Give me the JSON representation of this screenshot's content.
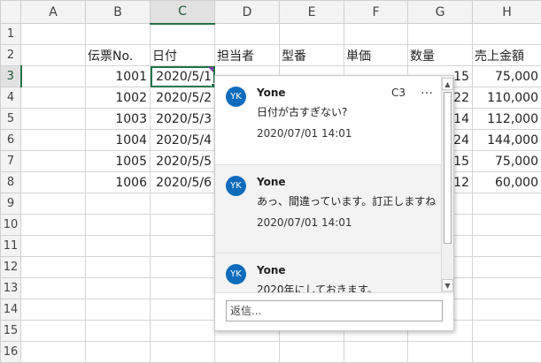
{
  "columns": [
    "A",
    "B",
    "C",
    "D",
    "E",
    "F",
    "G",
    "H"
  ],
  "rows": [
    "1",
    "2",
    "3",
    "4",
    "5",
    "6",
    "7",
    "8",
    "9",
    "10",
    "11",
    "12",
    "13",
    "14",
    "15",
    "16"
  ],
  "headers": {
    "slip_no": "伝票No.",
    "date": "日付",
    "person": "担当者",
    "model": "型番",
    "unit_price": "単価",
    "quantity": "数量",
    "sales_amount": "売上金額"
  },
  "records": [
    {
      "slip": "1001",
      "date": "2020/5/1",
      "qty_tail": "15",
      "amount": "75,000"
    },
    {
      "slip": "1002",
      "date": "2020/5/2",
      "qty_tail": "22",
      "amount": "110,000"
    },
    {
      "slip": "1003",
      "date": "2020/5/3",
      "qty_tail": "14",
      "amount": "112,000"
    },
    {
      "slip": "1004",
      "date": "2020/5/4",
      "qty_tail": "24",
      "amount": "144,000"
    },
    {
      "slip": "1005",
      "date": "2020/5/5",
      "qty_tail": "15",
      "amount": "75,000"
    },
    {
      "slip": "1006",
      "date": "2020/5/6",
      "qty_tail": "12",
      "amount": "60,000"
    }
  ],
  "comment": {
    "cell_ref": "C3",
    "more_icon": "…",
    "entries": [
      {
        "initials": "YK",
        "author": "Yone",
        "text": "日付が古すぎない?",
        "time": "2020/07/01 14:01"
      },
      {
        "initials": "YK",
        "author": "Yone",
        "text": "あっ、間違っています。訂正しますね",
        "time": "2020/07/01 14:01"
      },
      {
        "initials": "YK",
        "author": "Yone",
        "text": "2020年にしておきます。"
      }
    ],
    "reply_placeholder": "返信..."
  },
  "icons": {
    "scroll_up": "▲",
    "scroll_down": "▼"
  },
  "colors": {
    "accent": "#217346",
    "avatar": "#0f6cbd",
    "comment_marker": "#7e3fa0"
  }
}
